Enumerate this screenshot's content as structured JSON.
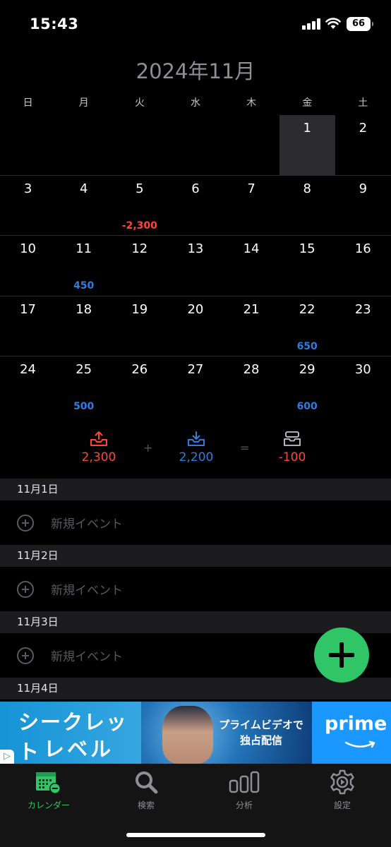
{
  "status_bar": {
    "time": "15:43",
    "battery": "66"
  },
  "calendar": {
    "title": "2024年11月",
    "weekdays": [
      "日",
      "月",
      "火",
      "水",
      "木",
      "金",
      "土"
    ],
    "weeks": [
      [
        {
          "day": ""
        },
        {
          "day": ""
        },
        {
          "day": ""
        },
        {
          "day": ""
        },
        {
          "day": ""
        },
        {
          "day": "1",
          "selected": true
        },
        {
          "day": "2"
        }
      ],
      [
        {
          "day": "3"
        },
        {
          "day": "4"
        },
        {
          "day": "5",
          "amount": "-2,300",
          "type": "neg"
        },
        {
          "day": "6"
        },
        {
          "day": "7"
        },
        {
          "day": "8"
        },
        {
          "day": "9"
        }
      ],
      [
        {
          "day": "10"
        },
        {
          "day": "11",
          "amount": "450",
          "type": "pos"
        },
        {
          "day": "12"
        },
        {
          "day": "13"
        },
        {
          "day": "14"
        },
        {
          "day": "15"
        },
        {
          "day": "16"
        }
      ],
      [
        {
          "day": "17"
        },
        {
          "day": "18"
        },
        {
          "day": "19"
        },
        {
          "day": "20"
        },
        {
          "day": "21"
        },
        {
          "day": "22",
          "amount": "650",
          "type": "pos"
        },
        {
          "day": "23"
        }
      ],
      [
        {
          "day": "24"
        },
        {
          "day": "25",
          "amount": "500",
          "type": "pos"
        },
        {
          "day": "26"
        },
        {
          "day": "27"
        },
        {
          "day": "28"
        },
        {
          "day": "29",
          "amount": "600",
          "type": "pos"
        },
        {
          "day": "30"
        }
      ]
    ]
  },
  "summary": {
    "expense": "2,300",
    "plus": "+",
    "income": "2,200",
    "equals": "=",
    "balance": "-100"
  },
  "events": [
    {
      "date": "11月1日",
      "new_label": "新規イベント"
    },
    {
      "date": "11月2日",
      "new_label": "新規イベント"
    },
    {
      "date": "11月3日",
      "new_label": "新規イベント"
    },
    {
      "date": "11月4日"
    }
  ],
  "ad": {
    "line1": "シークレット",
    "line2": "レベル",
    "promo_line1": "プライムビデオで",
    "promo_line2": "独占配信",
    "brand": "prime"
  },
  "tabs": [
    {
      "label": "カレンダー",
      "icon": "calendar-icon",
      "active": true
    },
    {
      "label": "検索",
      "icon": "search-icon"
    },
    {
      "label": "分析",
      "icon": "chart-icon"
    },
    {
      "label": "設定",
      "icon": "gear-icon"
    }
  ],
  "colors": {
    "accent": "#30c566",
    "expense": "#ff453a",
    "income": "#2f7de1"
  }
}
